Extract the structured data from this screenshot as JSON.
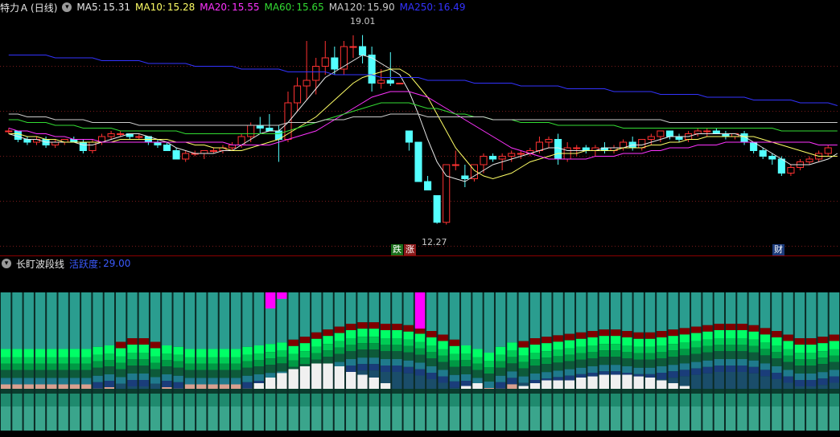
{
  "header": {
    "stock_name": "特力Ａ",
    "period": "(日线)",
    "ma": [
      {
        "label": "MA5:",
        "value": "15.31",
        "color": "#e8e8e8"
      },
      {
        "label": "MA10:",
        "value": "15.28",
        "color": "#ffff66"
      },
      {
        "label": "MA20:",
        "value": "15.55",
        "color": "#ff33ff"
      },
      {
        "label": "MA60:",
        "value": "15.65",
        "color": "#33dd33"
      },
      {
        "label": "MA120:",
        "value": "15.90",
        "color": "#cccccc"
      },
      {
        "label": "MA250:",
        "value": "16.49",
        "color": "#3333ff"
      }
    ]
  },
  "annotations": {
    "high_price": "19.01",
    "low_price": "12.27",
    "tag_fall": "跌",
    "tag_rise": "涨",
    "tag_finance": "财"
  },
  "indicator": {
    "name": "长盯波段线",
    "param_label": "活跃度:",
    "param_value": "29.00"
  },
  "chart_data": {
    "type": "candlestick",
    "price_range": [
      11.6,
      19.6
    ],
    "colors": {
      "up": "#ff3232",
      "down": "#54ffff"
    },
    "candles": [
      [
        15.6,
        15.7,
        15.5,
        15.6
      ],
      [
        15.6,
        15.6,
        15.2,
        15.3
      ],
      [
        15.3,
        15.4,
        15.1,
        15.2
      ],
      [
        15.2,
        15.4,
        15.1,
        15.3
      ],
      [
        15.3,
        15.4,
        15.0,
        15.1
      ],
      [
        15.1,
        15.3,
        15.0,
        15.2
      ],
      [
        15.2,
        15.3,
        15.1,
        15.3
      ],
      [
        15.3,
        15.4,
        15.2,
        15.2
      ],
      [
        15.2,
        15.3,
        14.8,
        14.9
      ],
      [
        14.9,
        15.3,
        14.8,
        15.2
      ],
      [
        15.2,
        15.5,
        15.1,
        15.4
      ],
      [
        15.4,
        15.6,
        15.3,
        15.5
      ],
      [
        15.5,
        15.6,
        15.4,
        15.5
      ],
      [
        15.5,
        15.5,
        15.3,
        15.4
      ],
      [
        15.4,
        15.5,
        15.3,
        15.4
      ],
      [
        15.4,
        15.4,
        15.1,
        15.2
      ],
      [
        15.2,
        15.3,
        15.0,
        15.1
      ],
      [
        15.1,
        15.2,
        14.9,
        14.9
      ],
      [
        14.9,
        15.0,
        14.6,
        14.6
      ],
      [
        14.6,
        14.9,
        14.5,
        14.8
      ],
      [
        14.8,
        14.9,
        14.7,
        14.8
      ],
      [
        14.8,
        14.9,
        14.6,
        14.9
      ],
      [
        14.9,
        15.0,
        14.8,
        14.9
      ],
      [
        14.9,
        15.1,
        14.8,
        15.0
      ],
      [
        15.0,
        15.2,
        14.9,
        15.1
      ],
      [
        15.1,
        15.5,
        15.0,
        15.4
      ],
      [
        15.4,
        15.9,
        15.2,
        15.8
      ],
      [
        15.8,
        16.1,
        15.5,
        15.7
      ],
      [
        15.7,
        16.2,
        15.6,
        15.6
      ],
      [
        15.6,
        15.8,
        14.5,
        15.3
      ],
      [
        15.3,
        17.0,
        15.2,
        16.6
      ],
      [
        16.6,
        17.5,
        16.3,
        17.2
      ],
      [
        17.2,
        18.8,
        16.7,
        17.4
      ],
      [
        17.4,
        18.2,
        16.9,
        17.9
      ],
      [
        17.9,
        18.8,
        17.6,
        18.2
      ],
      [
        18.2,
        18.6,
        17.6,
        17.8
      ],
      [
        17.8,
        18.8,
        17.6,
        18.6
      ],
      [
        18.6,
        19.0,
        18.2,
        18.6
      ],
      [
        18.6,
        19.01,
        18.0,
        18.3
      ],
      [
        18.3,
        18.6,
        17.0,
        17.3
      ],
      [
        17.3,
        17.8,
        17.1,
        17.4
      ],
      [
        17.4,
        18.4,
        17.2,
        17.3
      ],
      [
        17.3,
        17.3,
        17.3,
        17.3
      ],
      [
        15.6,
        15.6,
        14.9,
        15.2
      ],
      [
        15.2,
        15.2,
        13.9,
        13.8
      ],
      [
        13.8,
        14.0,
        13.5,
        13.5
      ],
      [
        13.3,
        13.3,
        12.3,
        12.35
      ],
      [
        12.35,
        14.4,
        12.27,
        14.4
      ],
      [
        14.4,
        14.9,
        14.2,
        14.4
      ],
      [
        14.0,
        14.4,
        13.6,
        13.9
      ],
      [
        13.9,
        14.3,
        13.8,
        14.4
      ],
      [
        14.4,
        14.8,
        14.1,
        14.7
      ],
      [
        14.7,
        14.8,
        14.5,
        14.6
      ],
      [
        14.6,
        14.8,
        14.2,
        14.7
      ],
      [
        14.7,
        14.9,
        14.5,
        14.8
      ],
      [
        14.8,
        14.9,
        14.6,
        14.8
      ],
      [
        14.8,
        15.0,
        14.7,
        14.9
      ],
      [
        14.9,
        15.4,
        14.8,
        15.2
      ],
      [
        15.2,
        15.4,
        15.0,
        15.3
      ],
      [
        15.3,
        15.5,
        14.4,
        14.6
      ],
      [
        14.6,
        15.2,
        14.5,
        15.0
      ],
      [
        15.0,
        15.1,
        14.7,
        15.0
      ],
      [
        15.0,
        15.1,
        14.8,
        14.9
      ],
      [
        14.9,
        15.1,
        14.7,
        15.0
      ],
      [
        15.0,
        15.2,
        14.8,
        14.9
      ],
      [
        14.9,
        15.1,
        14.8,
        15.0
      ],
      [
        15.0,
        15.3,
        14.9,
        15.2
      ],
      [
        15.2,
        15.4,
        14.9,
        15.0
      ],
      [
        15.0,
        15.3,
        14.9,
        15.3
      ],
      [
        15.3,
        15.5,
        15.1,
        15.4
      ],
      [
        15.4,
        15.6,
        15.2,
        15.6
      ],
      [
        15.6,
        15.6,
        15.3,
        15.4
      ],
      [
        15.4,
        15.5,
        15.2,
        15.3
      ],
      [
        15.3,
        15.6,
        15.2,
        15.5
      ],
      [
        15.5,
        15.7,
        15.4,
        15.6
      ],
      [
        15.6,
        15.7,
        15.4,
        15.6
      ],
      [
        15.6,
        15.7,
        15.5,
        15.5
      ],
      [
        15.5,
        15.6,
        15.3,
        15.4
      ],
      [
        15.4,
        15.5,
        15.3,
        15.5
      ],
      [
        15.5,
        15.6,
        15.1,
        15.2
      ],
      [
        15.2,
        15.2,
        14.8,
        14.9
      ],
      [
        14.9,
        15.0,
        14.6,
        14.7
      ],
      [
        14.7,
        14.8,
        14.4,
        14.6
      ],
      [
        14.6,
        14.7,
        14.0,
        14.1
      ],
      [
        14.1,
        14.4,
        14.0,
        14.3
      ],
      [
        14.3,
        14.6,
        14.2,
        14.5
      ],
      [
        14.5,
        14.7,
        14.4,
        14.6
      ],
      [
        14.6,
        14.9,
        14.5,
        14.8
      ],
      [
        14.8,
        15.1,
        14.7,
        15.0
      ]
    ],
    "ma_lines": [
      {
        "name": "MA5",
        "color": "#e8e8e8",
        "values": [
          15.5,
          15.4,
          15.3,
          15.3,
          15.2,
          15.2,
          15.2,
          15.2,
          15.1,
          15.1,
          15.2,
          15.3,
          15.4,
          15.5,
          15.5,
          15.4,
          15.3,
          15.2,
          15.0,
          14.9,
          14.8,
          14.8,
          14.8,
          14.9,
          14.9,
          15.1,
          15.3,
          15.5,
          15.6,
          15.6,
          15.9,
          16.3,
          16.7,
          17.1,
          17.5,
          17.7,
          17.9,
          18.1,
          18.3,
          18.2,
          18.0,
          17.8,
          17.6,
          17.0,
          16.2,
          15.3,
          14.5,
          14.0,
          13.9,
          13.8,
          14.0,
          14.2,
          14.4,
          14.5,
          14.6,
          14.7,
          14.8,
          14.9,
          15.0,
          15.0,
          14.9,
          14.9,
          14.9,
          14.9,
          15.0,
          15.0,
          15.0,
          15.1,
          15.1,
          15.2,
          15.3,
          15.4,
          15.4,
          15.4,
          15.5,
          15.5,
          15.5,
          15.5,
          15.5,
          15.4,
          15.2,
          15.0,
          14.8,
          14.6,
          14.4,
          14.4,
          14.4,
          14.5,
          14.6,
          14.8
        ]
      },
      {
        "name": "MA10",
        "color": "#ffff66",
        "values": [
          15.5,
          15.5,
          15.4,
          15.4,
          15.3,
          15.3,
          15.2,
          15.2,
          15.2,
          15.2,
          15.2,
          15.2,
          15.3,
          15.3,
          15.3,
          15.3,
          15.3,
          15.3,
          15.2,
          15.2,
          15.1,
          15.1,
          15.0,
          15.0,
          14.9,
          14.9,
          15.0,
          15.1,
          15.2,
          15.3,
          15.5,
          15.7,
          15.9,
          16.1,
          16.4,
          16.7,
          17.0,
          17.3,
          17.5,
          17.6,
          17.7,
          17.8,
          17.8,
          17.6,
          17.2,
          16.8,
          16.2,
          15.6,
          15.0,
          14.6,
          14.2,
          14.0,
          13.9,
          14.0,
          14.1,
          14.3,
          14.5,
          14.6,
          14.7,
          14.8,
          14.8,
          14.8,
          14.9,
          14.9,
          14.9,
          14.9,
          15.0,
          15.0,
          15.0,
          15.1,
          15.1,
          15.2,
          15.2,
          15.3,
          15.3,
          15.4,
          15.4,
          15.4,
          15.4,
          15.4,
          15.4,
          15.3,
          15.2,
          15.1,
          15.0,
          14.9,
          14.8,
          14.7,
          14.7,
          14.7
        ]
      },
      {
        "name": "MA20",
        "color": "#ff33ff",
        "values": [
          15.7,
          15.6,
          15.6,
          15.5,
          15.5,
          15.4,
          15.4,
          15.3,
          15.3,
          15.3,
          15.2,
          15.2,
          15.2,
          15.2,
          15.2,
          15.2,
          15.2,
          15.2,
          15.2,
          15.2,
          15.2,
          15.2,
          15.2,
          15.2,
          15.1,
          15.1,
          15.1,
          15.1,
          15.1,
          15.2,
          15.3,
          15.4,
          15.5,
          15.6,
          15.8,
          16.0,
          16.2,
          16.4,
          16.6,
          16.8,
          16.9,
          17.0,
          17.0,
          17.0,
          16.9,
          16.8,
          16.6,
          16.4,
          16.2,
          16.0,
          15.8,
          15.6,
          15.4,
          15.2,
          15.0,
          14.9,
          14.8,
          14.7,
          14.6,
          14.6,
          14.6,
          14.6,
          14.6,
          14.7,
          14.7,
          14.7,
          14.8,
          14.8,
          14.8,
          14.9,
          14.9,
          15.0,
          15.0,
          15.0,
          15.1,
          15.1,
          15.1,
          15.2,
          15.2,
          15.2,
          15.2,
          15.2,
          15.2,
          15.2,
          15.2,
          15.2,
          15.2,
          15.1,
          15.1,
          15.1
        ]
      },
      {
        "name": "MA60",
        "color": "#33dd33",
        "values": [
          16.0,
          16.0,
          15.9,
          15.9,
          15.9,
          15.8,
          15.8,
          15.8,
          15.7,
          15.7,
          15.7,
          15.7,
          15.6,
          15.6,
          15.6,
          15.6,
          15.6,
          15.6,
          15.6,
          15.5,
          15.5,
          15.5,
          15.5,
          15.5,
          15.5,
          15.5,
          15.5,
          15.5,
          15.5,
          15.5,
          15.6,
          15.7,
          15.8,
          15.9,
          16.0,
          16.1,
          16.2,
          16.3,
          16.4,
          16.5,
          16.6,
          16.6,
          16.6,
          16.6,
          16.5,
          16.4,
          16.4,
          16.3,
          16.2,
          16.2,
          16.1,
          16.1,
          16.0,
          16.0,
          16.0,
          15.9,
          15.9,
          15.9,
          15.9,
          15.8,
          15.8,
          15.8,
          15.8,
          15.8,
          15.8,
          15.8,
          15.7,
          15.7,
          15.7,
          15.7,
          15.7,
          15.7,
          15.7,
          15.7,
          15.7,
          15.7,
          15.7,
          15.7,
          15.7,
          15.7,
          15.7,
          15.7,
          15.7,
          15.6,
          15.6,
          15.6,
          15.6,
          15.6,
          15.6,
          15.6
        ]
      },
      {
        "name": "MA120",
        "color": "#cccccc",
        "values": [
          16.2,
          16.2,
          16.1,
          16.1,
          16.1,
          16.0,
          16.0,
          16.0,
          16.0,
          15.9,
          15.9,
          15.9,
          15.9,
          15.9,
          15.8,
          15.8,
          15.8,
          15.8,
          15.8,
          15.8,
          15.8,
          15.8,
          15.8,
          15.8,
          15.8,
          15.8,
          15.8,
          15.8,
          15.8,
          15.8,
          15.9,
          15.9,
          15.9,
          15.9,
          16.0,
          16.0,
          16.0,
          16.1,
          16.1,
          16.1,
          16.1,
          16.2,
          16.2,
          16.2,
          16.2,
          16.1,
          16.1,
          16.1,
          16.1,
          16.1,
          16.1,
          16.1,
          16.0,
          16.0,
          16.0,
          16.0,
          16.0,
          16.0,
          16.0,
          16.0,
          16.0,
          16.0,
          16.0,
          16.0,
          16.0,
          16.0,
          16.0,
          16.0,
          16.0,
          16.0,
          16.0,
          15.9,
          15.9,
          15.9,
          15.9,
          15.9,
          15.9,
          15.9,
          15.9,
          15.9,
          15.9,
          15.9,
          15.9,
          15.9,
          15.9,
          15.9,
          15.9,
          15.9,
          15.9,
          15.9
        ]
      },
      {
        "name": "MA250",
        "color": "#3333ff",
        "values": [
          18.3,
          18.3,
          18.3,
          18.3,
          18.3,
          18.2,
          18.2,
          18.2,
          18.2,
          18.2,
          18.1,
          18.1,
          18.1,
          18.1,
          18.1,
          18.0,
          18.0,
          18.0,
          18.0,
          18.0,
          17.9,
          17.9,
          17.9,
          17.9,
          17.9,
          17.8,
          17.8,
          17.8,
          17.8,
          17.8,
          17.7,
          17.7,
          17.7,
          17.7,
          17.7,
          17.6,
          17.6,
          17.6,
          17.6,
          17.6,
          17.5,
          17.5,
          17.5,
          17.5,
          17.5,
          17.4,
          17.4,
          17.4,
          17.4,
          17.4,
          17.3,
          17.3,
          17.3,
          17.3,
          17.3,
          17.2,
          17.2,
          17.2,
          17.2,
          17.2,
          17.1,
          17.1,
          17.1,
          17.1,
          17.1,
          17.0,
          17.0,
          17.0,
          17.0,
          17.0,
          16.9,
          16.9,
          16.9,
          16.9,
          16.9,
          16.8,
          16.8,
          16.8,
          16.8,
          16.8,
          16.7,
          16.7,
          16.7,
          16.7,
          16.7,
          16.6,
          16.6,
          16.6,
          16.6,
          16.5
        ]
      }
    ]
  },
  "indicator_data": {
    "bars": 73,
    "upper_band_levels": [
      0.55,
      0.55,
      0.55,
      0.55,
      0.55,
      0.55,
      0.55,
      0.55,
      0.58,
      0.6,
      0.65,
      0.7,
      0.7,
      0.65,
      0.6,
      0.58,
      0.55,
      0.55,
      0.55,
      0.55,
      0.55,
      0.58,
      0.6,
      0.62,
      0.64,
      0.68,
      0.72,
      0.78,
      0.82,
      0.86,
      0.9,
      0.92,
      0.92,
      0.9,
      0.9,
      0.88,
      0.85,
      0.8,
      0.75,
      0.68,
      0.6,
      0.55,
      0.5,
      0.58,
      0.64,
      0.66,
      0.7,
      0.72,
      0.74,
      0.76,
      0.78,
      0.8,
      0.82,
      0.82,
      0.8,
      0.78,
      0.78,
      0.8,
      0.82,
      0.84,
      0.86,
      0.88,
      0.9,
      0.9,
      0.9,
      0.88,
      0.84,
      0.8,
      0.75,
      0.7,
      0.7,
      0.72,
      0.75
    ],
    "white_levels": [
      0,
      0,
      0,
      0,
      0,
      0,
      0,
      0,
      0,
      0,
      0,
      0,
      0,
      0,
      0,
      0,
      0,
      0,
      0,
      0,
      0,
      0,
      0.1,
      0.2,
      0.28,
      0.35,
      0.4,
      0.45,
      0.45,
      0.4,
      0.3,
      0.25,
      0.2,
      0.1,
      0,
      0,
      0,
      0,
      0,
      0,
      0.05,
      0.1,
      0,
      0,
      0,
      0.05,
      0.1,
      0.15,
      0.15,
      0.15,
      0.2,
      0.22,
      0.25,
      0.25,
      0.25,
      0.22,
      0.2,
      0.15,
      0.1,
      0.05,
      0,
      0,
      0,
      0,
      0,
      0,
      0,
      0,
      0,
      0,
      0,
      0,
      0
    ],
    "magenta_bars": [
      {
        "index": 23,
        "level": 0.2
      },
      {
        "index": 24,
        "level": 0.08
      },
      {
        "index": 36,
        "level": 0.45
      }
    ]
  }
}
